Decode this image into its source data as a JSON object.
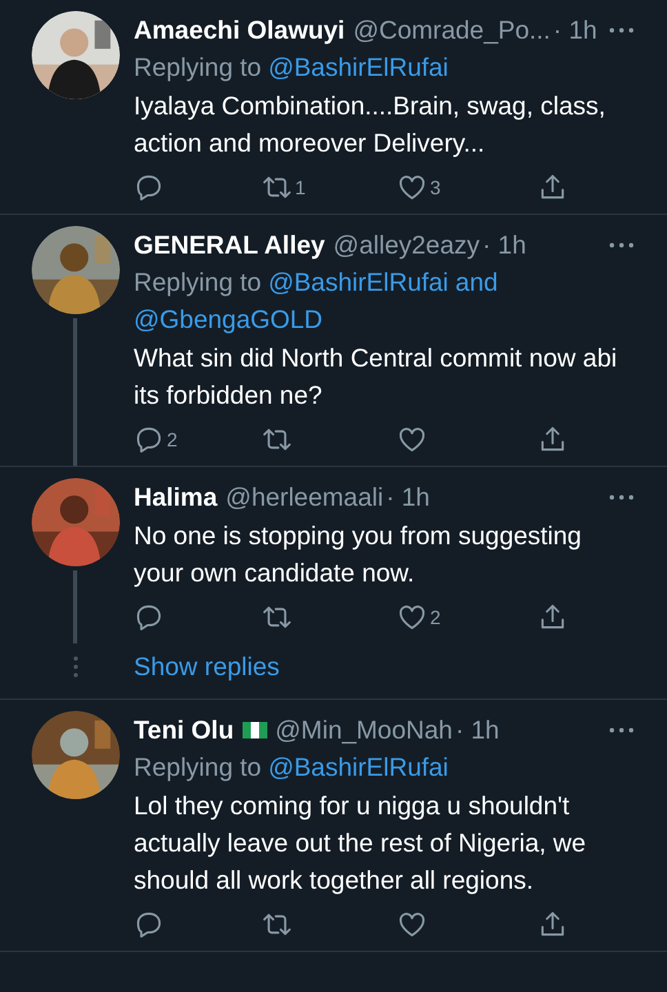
{
  "tweets": [
    {
      "name": "Amaechi Olawuyi",
      "handle": "@Comrade_Po...",
      "time": "· 1h",
      "replying": {
        "label": "Replying to",
        "handles": [
          "@BashirElRufai"
        ]
      },
      "text": "Iyalaya Combination....Brain, swag, class, action and moreover Delivery...",
      "actions": [
        {
          "kind": "reply"
        },
        {
          "kind": "retweet",
          "count": "1"
        },
        {
          "kind": "like",
          "count": "3"
        },
        {
          "kind": "share"
        }
      ]
    },
    {
      "name": "GENERAL Alley",
      "handle": "@alley2eazy",
      "time": "· 1h",
      "replying": {
        "label": "Replying to",
        "handles": [
          "@BashirElRufai",
          "@GbengaGOLD"
        ],
        "joiner": "and"
      },
      "text": "What sin did North Central commit now abi its forbidden ne?",
      "thread_line": true,
      "actions": [
        {
          "kind": "reply",
          "count": "2"
        },
        {
          "kind": "retweet"
        },
        {
          "kind": "like"
        },
        {
          "kind": "share"
        }
      ]
    },
    {
      "name": "Halima",
      "handle": "@herleemaali",
      "time": "· 1h",
      "text": "No one is stopping you from suggesting your own candidate now.",
      "thread_line": true,
      "actions": [
        {
          "kind": "reply"
        },
        {
          "kind": "retweet"
        },
        {
          "kind": "like",
          "count": "2"
        },
        {
          "kind": "share"
        }
      ],
      "show_replies": "Show replies"
    },
    {
      "name": "Teni Olu",
      "flag": true,
      "handle": "@Min_MooNah",
      "time": "· 1h",
      "replying": {
        "label": "Replying to",
        "handles": [
          "@BashirElRufai"
        ]
      },
      "text": "Lol they coming for u nigga u shouldn't actually leave out the rest of Nigeria, we should all work together all regions.",
      "actions": [
        {
          "kind": "reply"
        },
        {
          "kind": "retweet"
        },
        {
          "kind": "like"
        },
        {
          "kind": "share"
        }
      ]
    }
  ]
}
